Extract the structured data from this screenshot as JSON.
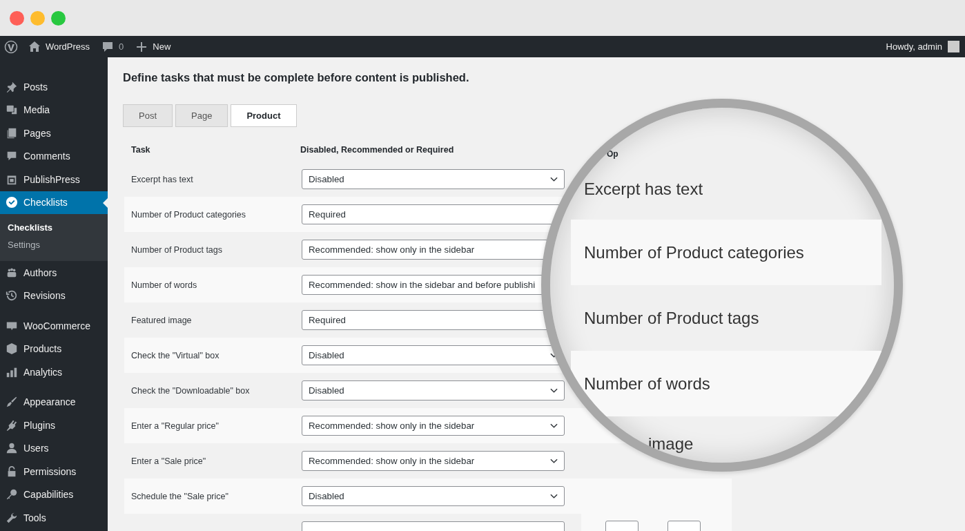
{
  "admin_bar": {
    "site": "WordPress",
    "comments": "0",
    "new": "New",
    "greeting": "Howdy, admin"
  },
  "sidebar": {
    "groups": [
      [
        {
          "label": "Posts",
          "kind": "pin",
          "selected": false
        },
        {
          "label": "Media",
          "kind": "media",
          "selected": false
        },
        {
          "label": "Pages",
          "kind": "pages",
          "selected": false
        },
        {
          "label": "Comments",
          "kind": "comment",
          "selected": false
        },
        {
          "label": "PublishPress",
          "kind": "calendar",
          "selected": false
        },
        {
          "label": "Checklists",
          "kind": "check",
          "selected": true,
          "children": [
            {
              "label": "Checklists",
              "selected": true
            },
            {
              "label": "Settings",
              "selected": false
            }
          ]
        },
        {
          "label": "Authors",
          "kind": "people",
          "selected": false
        },
        {
          "label": "Revisions",
          "kind": "clock",
          "selected": false
        }
      ],
      [
        {
          "label": "WooCommerce",
          "kind": "woo",
          "selected": false
        },
        {
          "label": "Products",
          "kind": "box",
          "selected": false
        },
        {
          "label": "Analytics",
          "kind": "bars",
          "selected": false
        }
      ],
      [
        {
          "label": "Appearance",
          "kind": "brush",
          "selected": false
        },
        {
          "label": "Plugins",
          "kind": "plug",
          "selected": false
        },
        {
          "label": "Users",
          "kind": "user",
          "selected": false
        },
        {
          "label": "Permissions",
          "kind": "lock",
          "selected": false
        },
        {
          "label": "Capabilities",
          "kind": "key",
          "selected": false
        },
        {
          "label": "Tools",
          "kind": "wrench",
          "selected": false
        }
      ]
    ]
  },
  "heading": "Define tasks that must be complete before content is published.",
  "tabs": [
    {
      "label": "Post",
      "selected": false
    },
    {
      "label": "Page",
      "selected": false
    },
    {
      "label": "Product",
      "selected": true
    }
  ],
  "table": {
    "columns": [
      "Task",
      "Disabled, Recommended or Required"
    ],
    "rows": [
      {
        "kind": "select",
        "task": "Excerpt has text",
        "value": "Disabled"
      },
      {
        "kind": "select",
        "task": "Number of Product categories",
        "value": "Required"
      },
      {
        "kind": "select",
        "task": "Number of Product tags",
        "value": "Recommended: show only in the sidebar"
      },
      {
        "kind": "select",
        "task": "Number of words",
        "value": "Recommended: show in the sidebar and before publishi"
      },
      {
        "kind": "select",
        "task": "Featured image",
        "value": "Required"
      },
      {
        "kind": "select",
        "task": "Check the \"Virtual\" box",
        "value": "Disabled"
      },
      {
        "kind": "select",
        "task": "Check the \"Downloadable\" box",
        "value": "Disabled"
      },
      {
        "kind": "select",
        "task": "Enter a \"Regular price\"",
        "value": "Recommended: show only in the sidebar"
      },
      {
        "kind": "select",
        "task": "Enter a \"Sale price\"",
        "value": "Recommended: show only in the sidebar"
      },
      {
        "kind": "select",
        "task": "Schedule the \"Sale price\"",
        "value": "Disabled"
      },
      {
        "kind": "number"
      }
    ]
  },
  "magnifier": {
    "header": "Op",
    "rows": [
      "Excerpt has text",
      "Number of Product categories",
      "Number of Product tags",
      "Number of words",
      "image"
    ]
  }
}
